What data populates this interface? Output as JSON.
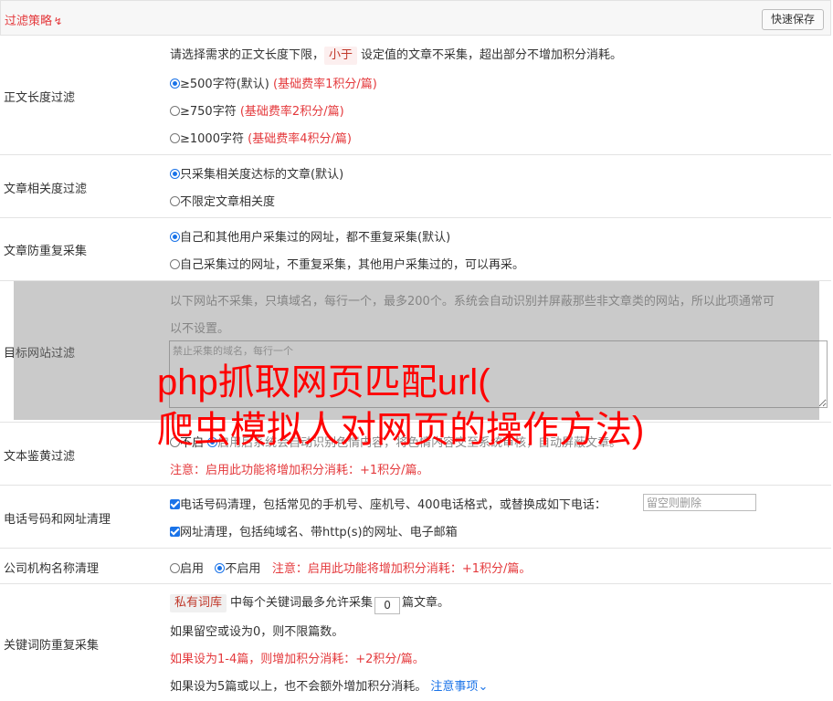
{
  "header": {
    "title": "过滤策略",
    "title_icon": "double-chevron-down-icon",
    "save_label": "快速保存"
  },
  "rows": {
    "length": {
      "label": "正文长度过滤",
      "desc_pre": "请选择需求的正文长度下限，",
      "desc_tag": "小于",
      "desc_post": "设定值的文章不采集，超出部分不增加积分消耗。",
      "options": [
        {
          "label": "≥500字符(默认)",
          "note": "(基础费率1积分/篇)",
          "selected": true
        },
        {
          "label": "≥750字符",
          "note": "(基础费率2积分/篇)",
          "selected": false
        },
        {
          "label": "≥1000字符",
          "note": "(基础费率4积分/篇)",
          "selected": false
        }
      ]
    },
    "relevance": {
      "label": "文章相关度过滤",
      "options": [
        {
          "label": "只采集相关度达标的文章(默认)",
          "selected": true
        },
        {
          "label": "不限定文章相关度",
          "selected": false
        }
      ]
    },
    "dedup": {
      "label": "文章防重复采集",
      "options": [
        {
          "label": "自己和其他用户采集过的网址，都不重复采集(默认)",
          "selected": true
        },
        {
          "label": "自己采集过的网址，不重复采集，其他用户采集过的，可以再采。",
          "selected": false
        }
      ]
    },
    "site": {
      "label": "目标网站过滤",
      "desc_line1": "以下网站不采集，只填域名，每行一个，最多200个。系统会自动识别并屏蔽那些非文章类的网站，所以此项通常可",
      "desc_line2": "以不设置。",
      "placeholder": "禁止采集的域名，每行一个"
    },
    "porn": {
      "label": "文本鉴黄过滤",
      "option_off": "不启",
      "option_text": "启用后系统会自动识别色情内容，将色情内容交至系统审核，自动屏蔽文章。",
      "notice": "注意：启用此功能将增加积分消耗：+1积分/篇。"
    },
    "phone": {
      "label": "电话号码和网址清理",
      "phone_text": "电话号码清理，包括常见的手机号、座机号、400电话格式，或替换成如下电话：",
      "phone_placeholder": "留空则删除",
      "url_text": "网址清理，包括纯域名、带http(s)的网址、电子邮箱"
    },
    "company": {
      "label": "公司机构名称清理",
      "opt_on": "启用",
      "opt_off": "不启用",
      "notice": "注意：启用此功能将增加积分消耗：+1积分/篇。"
    },
    "keyword": {
      "label": "关键词防重复采集",
      "tag": "私有词库",
      "line1_pre": "中每个关键词最多允许采集",
      "count": "0",
      "line1_post": "篇文章。",
      "line2": "如果留空或设为0，则不限篇数。",
      "line3": "如果设为1-4篇，则增加积分消耗：+2积分/篇。",
      "line4": "如果设为5篇或以上，也不会额外增加积分消耗。",
      "notice_link": "注意事项"
    }
  },
  "watermark": {
    "line1": "php抓取网页匹配url(",
    "line2": "爬虫模拟人对网页的操作方法)"
  },
  "colors": {
    "accent_red": "#e4393c",
    "link_blue": "#1a73e8",
    "overlay_gray": "#808080"
  }
}
